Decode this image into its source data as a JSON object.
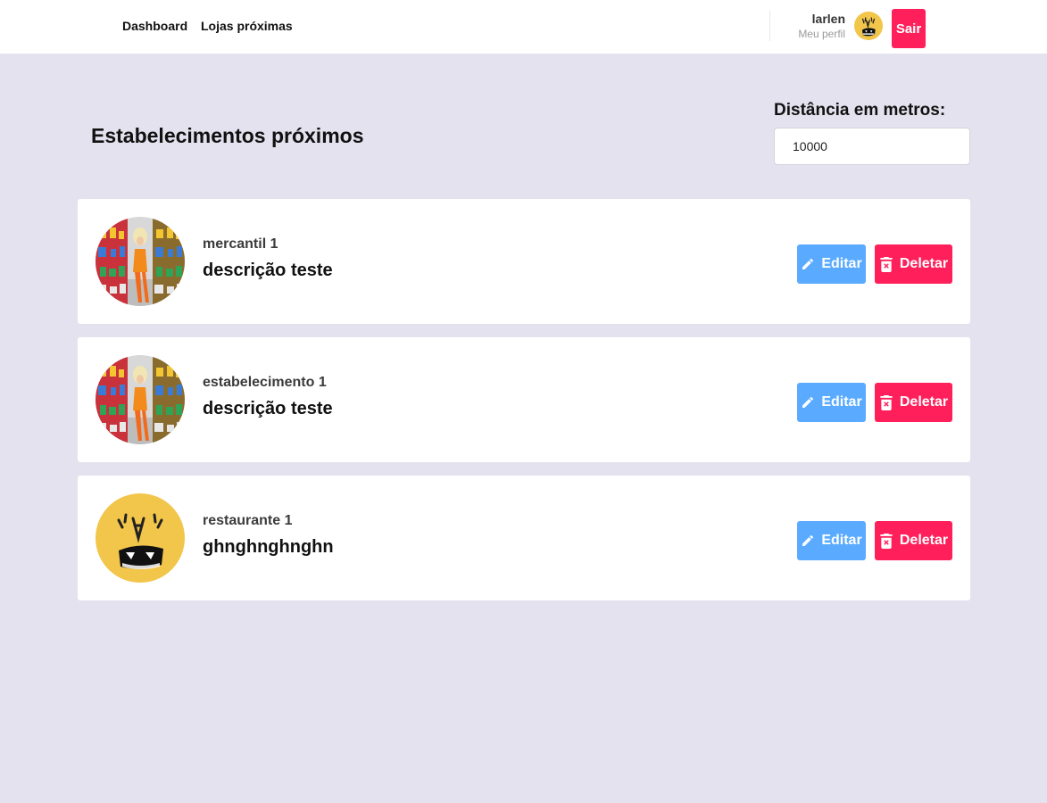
{
  "nav": {
    "items": [
      {
        "label": "Dashboard"
      },
      {
        "label": "Lojas próximas"
      }
    ]
  },
  "profile": {
    "name": "larlen",
    "link_label": "Meu perfil",
    "avatar_icon": "monster-face-avatar",
    "logout_label": "Sair"
  },
  "header": {
    "title": "Estabelecimentos próximos",
    "distance_label": "Distância em metros:",
    "distance_value": "10000"
  },
  "stores": [
    {
      "name": "mercantil 1",
      "description": "descrição teste",
      "image": "supermarket-photo",
      "edit_label": "Editar",
      "delete_label": "Deletar"
    },
    {
      "name": "estabelecimento 1",
      "description": "descrição teste",
      "image": "supermarket-photo",
      "edit_label": "Editar",
      "delete_label": "Deletar"
    },
    {
      "name": "restaurante 1",
      "description": "ghnghnghnghn",
      "image": "monster-face-avatar",
      "edit_label": "Editar",
      "delete_label": "Deletar"
    }
  ],
  "colors": {
    "background": "#e4e2ee",
    "edit_button": "#5aabff",
    "delete_button": "#ff1f5a",
    "logout_button": "#ff1f5a",
    "avatar_yellow": "#f2c54b"
  }
}
